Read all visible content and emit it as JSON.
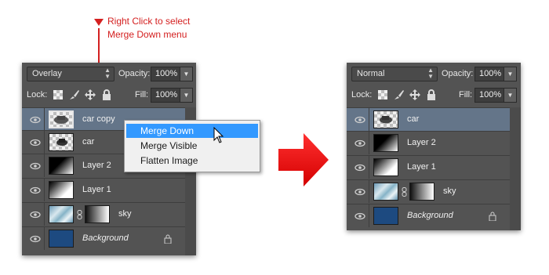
{
  "annotation": {
    "line1": "Right Click to select",
    "line2": "Merge Down menu"
  },
  "before_panel": {
    "blend_mode": "Overlay",
    "opacity_label": "Opacity:",
    "opacity_value": "100%",
    "lock_label": "Lock:",
    "fill_label": "Fill:",
    "fill_value": "100%",
    "layers": [
      {
        "name": "car copy",
        "selected": true
      },
      {
        "name": "car"
      },
      {
        "name": "Layer 2"
      },
      {
        "name": "Layer 1"
      },
      {
        "name": "sky"
      },
      {
        "name": "Background"
      }
    ]
  },
  "context_menu": {
    "items": [
      "Merge Down",
      "Merge Visible",
      "Flatten Image"
    ],
    "highlighted": "Merge Down"
  },
  "after_panel": {
    "blend_mode": "Normal",
    "opacity_label": "Opacity:",
    "opacity_value": "100%",
    "lock_label": "Lock:",
    "fill_label": "Fill:",
    "fill_value": "100%",
    "layers": [
      {
        "name": "car",
        "selected": true
      },
      {
        "name": "Layer 2"
      },
      {
        "name": "Layer 1"
      },
      {
        "name": "sky"
      },
      {
        "name": "Background"
      }
    ]
  },
  "colors": {
    "annotation_red": "#d42020",
    "arrow_red": "#ee1111",
    "menu_highlight": "#3399ff",
    "selected_layer": "#647589",
    "panel_bg": "#535353"
  }
}
